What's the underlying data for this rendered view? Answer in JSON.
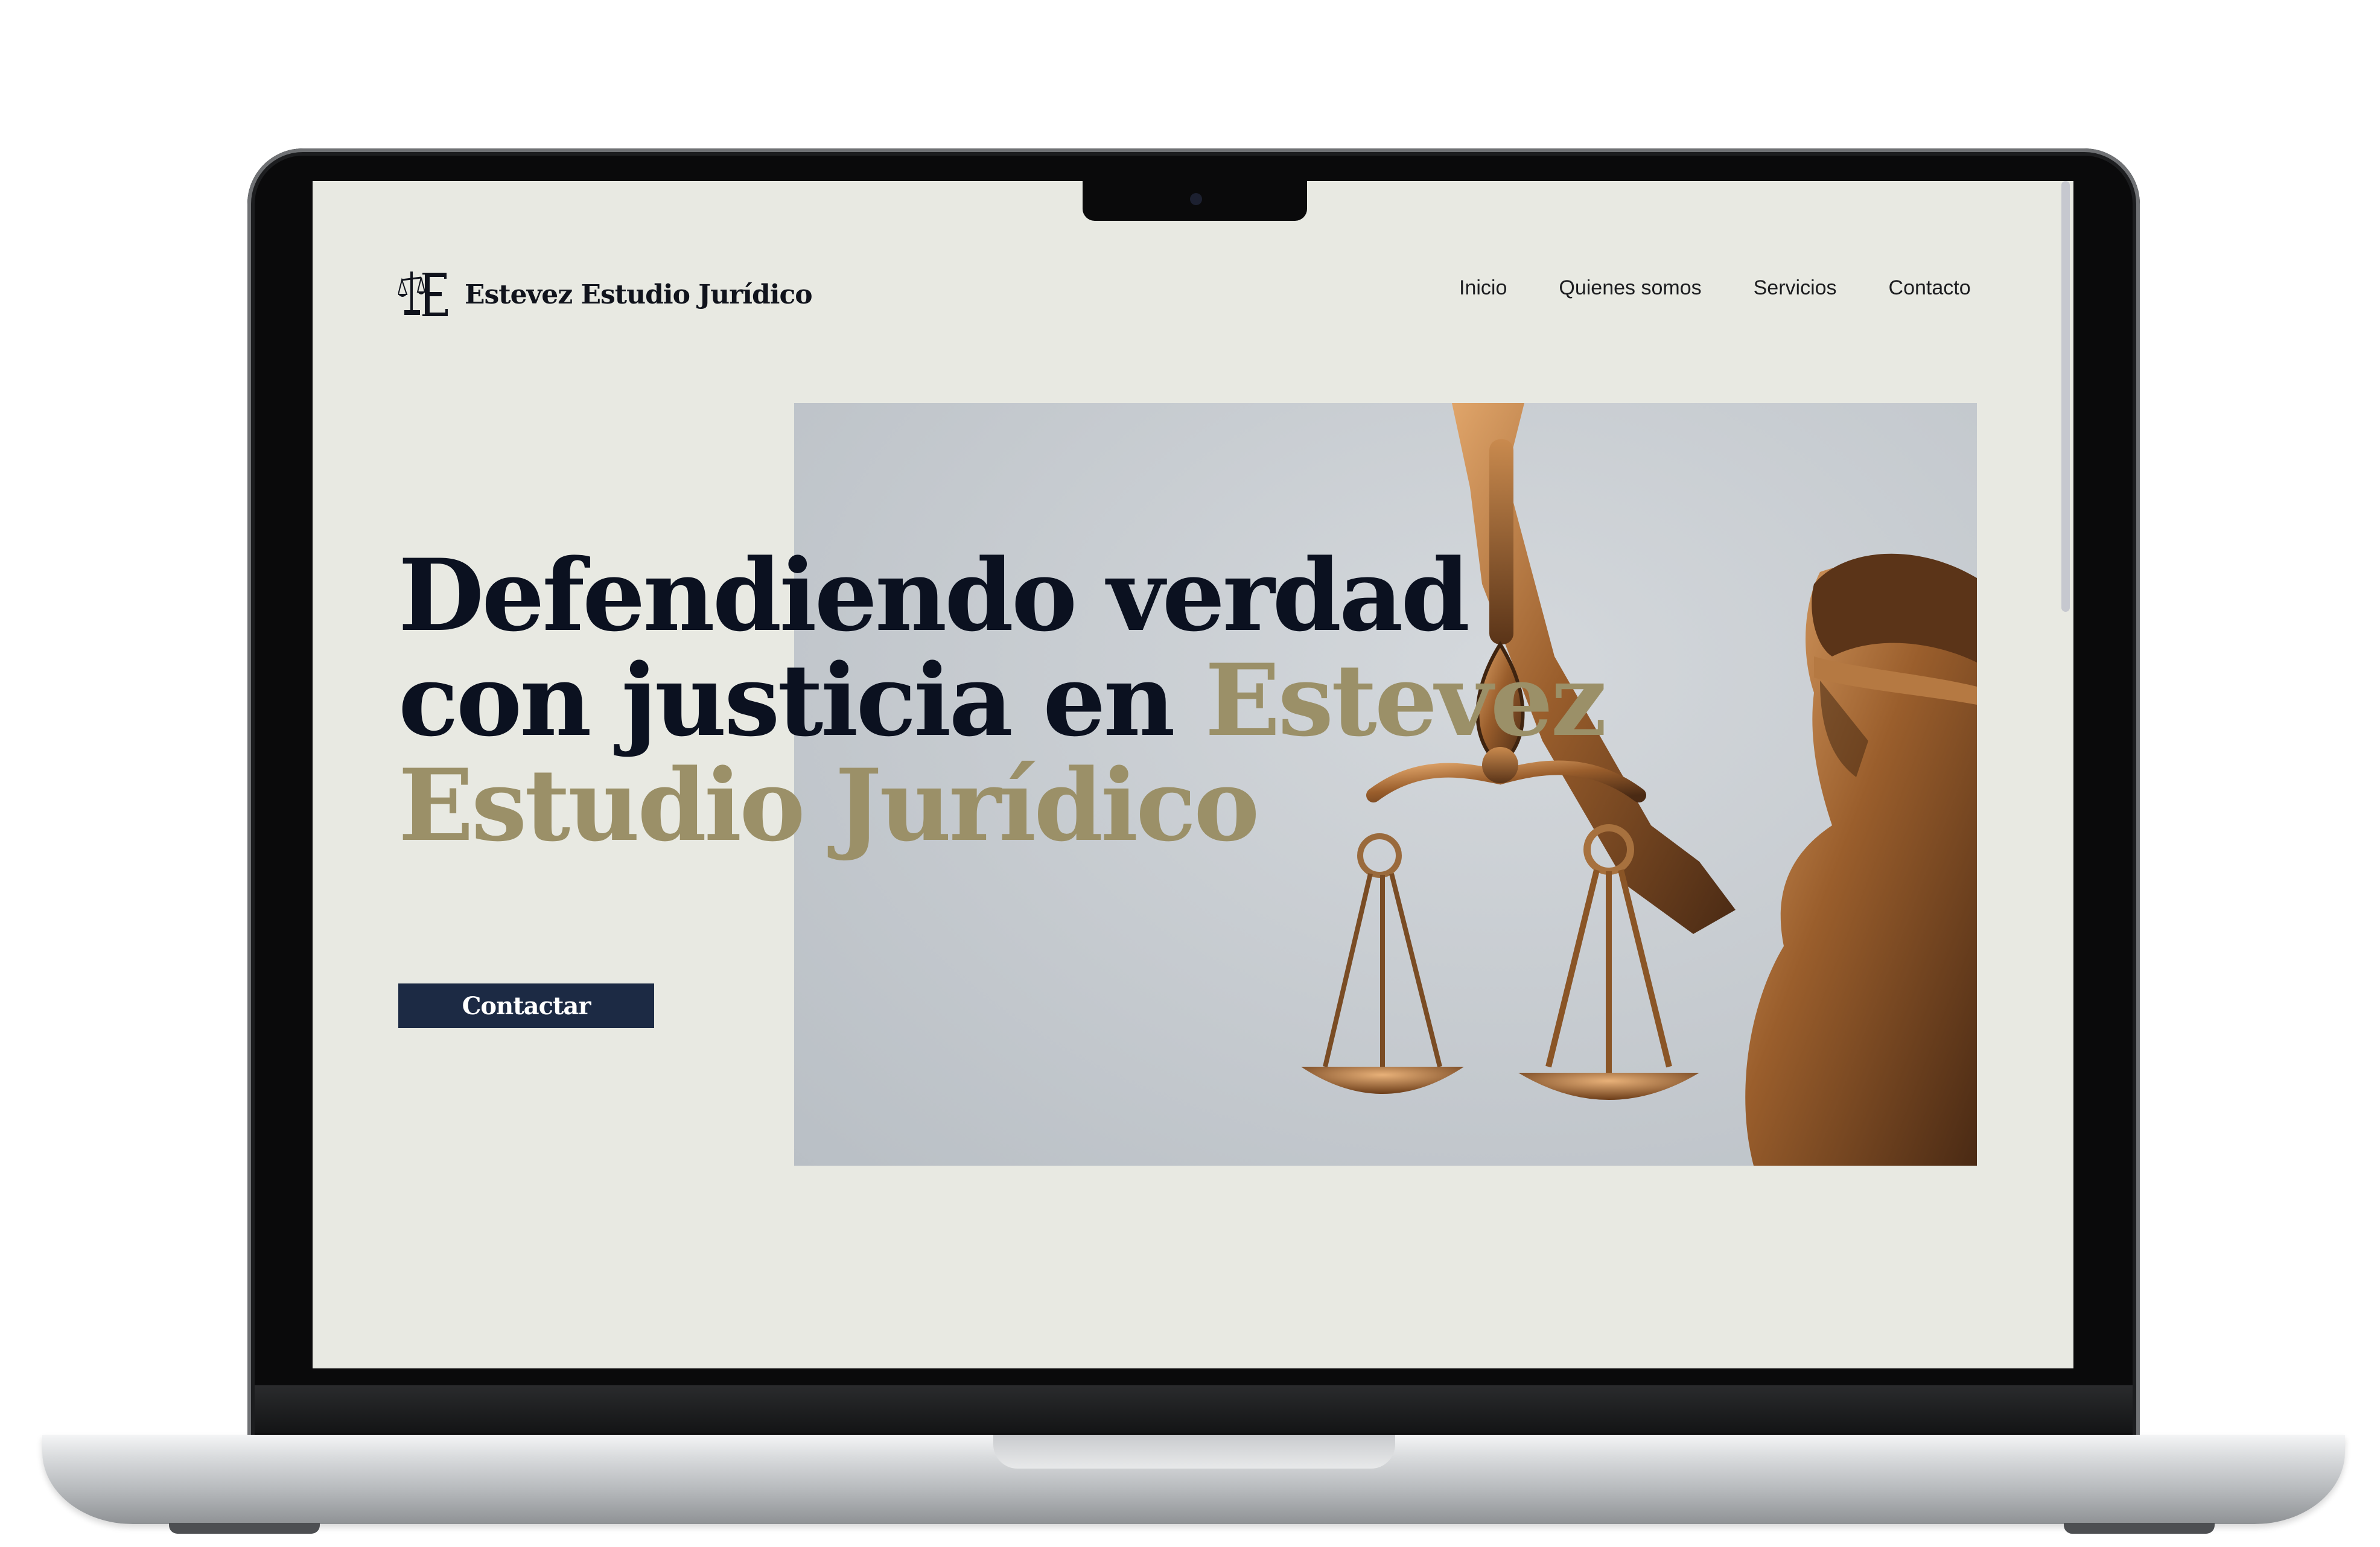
{
  "brand": {
    "name": "Estevez Estudio Jurídico",
    "logo_icon": "scales-of-justice-E-monogram"
  },
  "nav": {
    "items": [
      {
        "label": "Inicio"
      },
      {
        "label": "Quienes somos"
      },
      {
        "label": "Servicios"
      },
      {
        "label": "Contacto"
      }
    ]
  },
  "hero": {
    "headline_part1": "Defendiendo verdad con justicia en ",
    "headline_accent": "Estevez Estudio Jurídico",
    "cta_label": "Contactar",
    "image_subject": "lady-justice-statue-with-scales"
  },
  "colors": {
    "background": "#e8e9e2",
    "headline": "#0b1120",
    "accent": "#9b9068",
    "button": "#1c2a44"
  }
}
